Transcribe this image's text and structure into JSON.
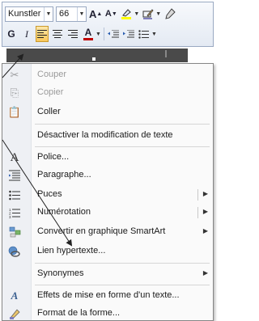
{
  "mini_toolbar": {
    "font_name": "Kunstler",
    "font_size": "66",
    "grow_font": "A",
    "shrink_font": "A",
    "bold": "G",
    "italic": "I",
    "font_color_letter": "A",
    "colors": {
      "font_color": "#c00000",
      "highlight": "#ffff00",
      "accent": "#f9c85a"
    }
  },
  "context_menu": {
    "items": [
      {
        "label": "Couper",
        "icon": "scissors-icon",
        "enabled": false,
        "submenu": false
      },
      {
        "label": "Copier",
        "icon": "copy-icon",
        "enabled": false,
        "submenu": false
      },
      {
        "label": "Coller",
        "icon": "paste-icon",
        "enabled": true,
        "submenu": false
      },
      {
        "label": "Désactiver la modification de texte",
        "icon": "",
        "enabled": true,
        "submenu": false
      },
      {
        "label": "Police...",
        "icon": "font-icon",
        "enabled": true,
        "submenu": false
      },
      {
        "label": "Paragraphe...",
        "icon": "paragraph-icon",
        "enabled": true,
        "submenu": false
      },
      {
        "label": "Puces",
        "icon": "bullets-icon",
        "enabled": true,
        "submenu": true
      },
      {
        "label": "Numérotation",
        "icon": "numbering-icon",
        "enabled": true,
        "submenu": true
      },
      {
        "label": "Convertir en graphique SmartArt",
        "icon": "smartart-icon",
        "enabled": true,
        "submenu": true
      },
      {
        "label": "Lien hypertexte...",
        "icon": "hyperlink-icon",
        "enabled": true,
        "submenu": false
      },
      {
        "label": "Synonymes",
        "icon": "",
        "enabled": true,
        "submenu": true
      },
      {
        "label": "Effets de mise en forme d'un texte...",
        "icon": "text-effects-icon",
        "enabled": true,
        "submenu": false
      },
      {
        "label": "Format de la forme...",
        "icon": "shape-format-icon",
        "enabled": true,
        "submenu": false
      }
    ]
  }
}
